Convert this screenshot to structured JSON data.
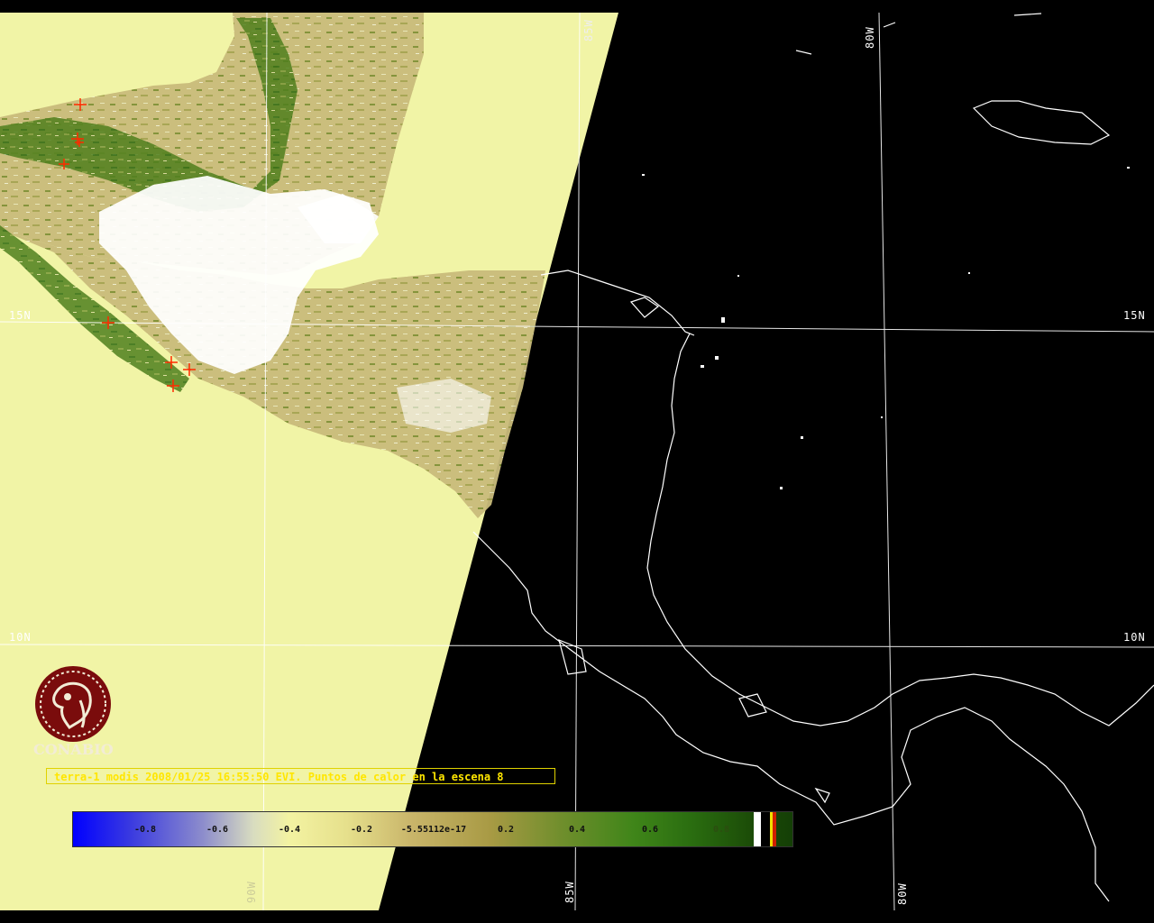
{
  "map": {
    "lat_labels_left": [
      "15N",
      "10N"
    ],
    "lat_labels_right": [
      "15N",
      "10N"
    ],
    "lon_labels_top": [
      "85W",
      "80W"
    ],
    "lon_labels_bottom": [
      "90W",
      "85W",
      "80W"
    ],
    "colors": {
      "land_bg": "#f1f4a6",
      "night_bg": "#000000",
      "coast": "#ffffff",
      "grid": "#ffffff",
      "hotspot": "#ff2a00"
    }
  },
  "caption": {
    "text": "terra-1 modis 2008/01/25 16:55:50 EVI. Puntos de calor en la escena 8"
  },
  "colorbar": {
    "ticks": [
      "-0.8",
      "-0.6",
      "-0.4",
      "-0.2",
      "-5.55112e-17",
      "0.2",
      "0.4",
      "0.6",
      "0.8"
    ]
  },
  "logo": {
    "text": "CONABIO",
    "icon": "conabio-emblem-icon"
  }
}
